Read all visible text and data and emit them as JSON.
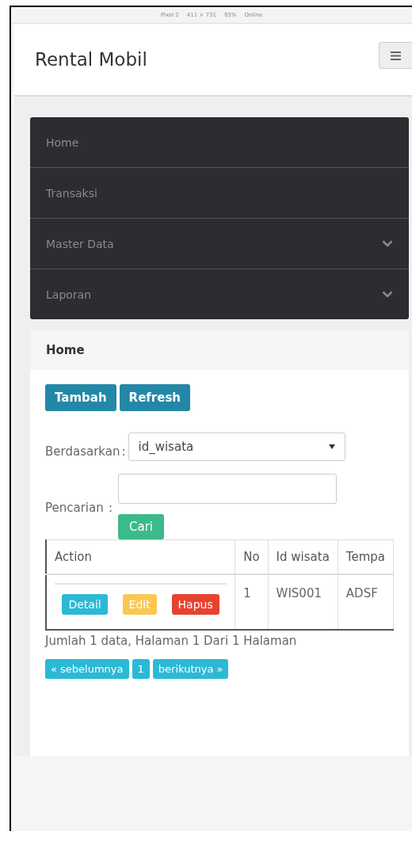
{
  "device_toolbar": {
    "device": "Pixel 2",
    "size": "411 × 731",
    "zoom": "93%",
    "network": "Online"
  },
  "navbar": {
    "brand": "Rental Mobil"
  },
  "menu": [
    {
      "label": "Home",
      "has_submenu": false
    },
    {
      "label": "Transaksi",
      "has_submenu": false
    },
    {
      "label": "Master Data",
      "has_submenu": true
    },
    {
      "label": "Laporan",
      "has_submenu": true
    }
  ],
  "panel": {
    "title": "Home",
    "buttons": [
      "Tambah",
      "Refresh"
    ],
    "filter": {
      "label": "Berdasarkan",
      "colon": ":",
      "value": "id_wisata"
    },
    "search": {
      "label": "Pencarian",
      "colon": ":",
      "button": "Cari"
    },
    "table": {
      "columns": [
        "Action",
        "No",
        "Id wisata",
        "Tempa"
      ],
      "rows": [
        [
          {
            "buttons": [
              {
                "label": "Detail",
                "kind": "info"
              },
              {
                "label": "Edit",
                "kind": "warning"
              },
              {
                "label": "Hapus",
                "kind": "danger"
              }
            ]
          },
          "1",
          "WIS001",
          "ADSF"
        ]
      ]
    },
    "summary": "Jumlah 1 data, Halaman 1 Dari 1 Halaman",
    "pagination": [
      "« sebelumnya",
      "1",
      "berikutnya »"
    ]
  }
}
